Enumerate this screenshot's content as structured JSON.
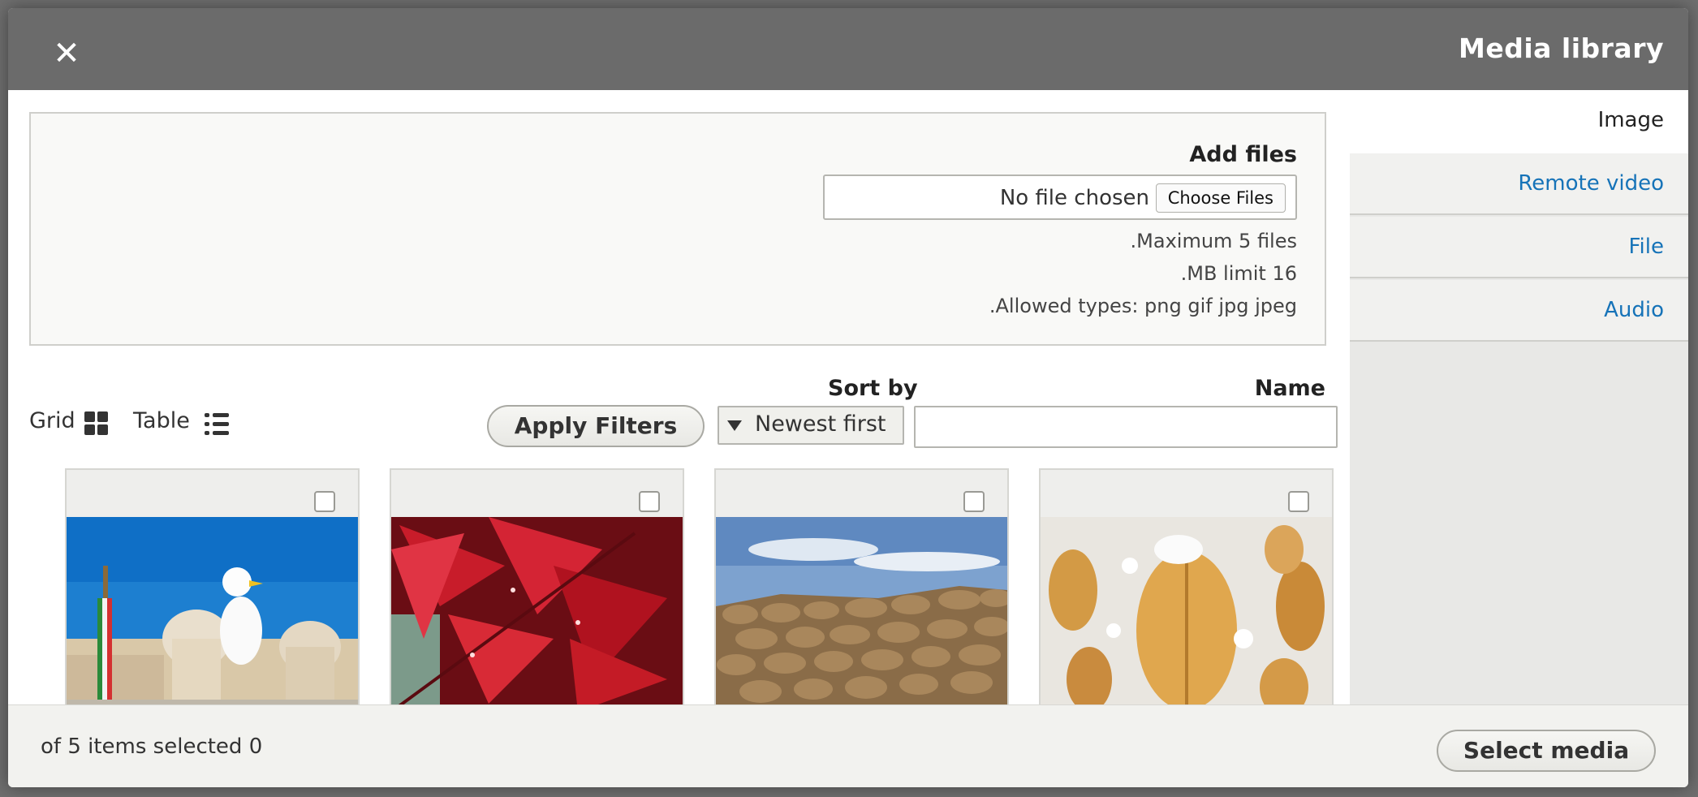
{
  "dialog": {
    "title": "Media library",
    "close_icon": "close-icon"
  },
  "tabs": [
    {
      "label": "Image",
      "active": true
    },
    {
      "label": "Remote video",
      "active": false
    },
    {
      "label": "File",
      "active": false
    },
    {
      "label": "Audio",
      "active": false
    }
  ],
  "upload": {
    "label": "Add files",
    "file_status": "No file chosen",
    "choose_button": "Choose Files",
    "descriptions": [
      ".Maximum 5 files",
      ".MB limit 16",
      ".Allowed types: png gif jpg jpeg"
    ]
  },
  "view": {
    "grid_label": "Grid",
    "table_label": "Table",
    "grid_icon": "grid-icon",
    "table_icon": "list-icon"
  },
  "filters": {
    "apply_label": "Apply Filters",
    "sort_label": "Sort by",
    "sort_value": "Newest first",
    "name_label": "Name",
    "name_value": ""
  },
  "media_items": [
    {
      "checked": false,
      "subject": "seagull-rome-photo"
    },
    {
      "checked": false,
      "subject": "red-leaves-photo"
    },
    {
      "checked": false,
      "subject": "stone-wall-photo"
    },
    {
      "checked": false,
      "subject": "frosted-leaves-photo"
    }
  ],
  "footer": {
    "selected_text": "of 5 items selected 0",
    "select_button": "Select media"
  },
  "colors": {
    "titlebar": "#6b6b6b",
    "tab_link": "#1673b8"
  }
}
